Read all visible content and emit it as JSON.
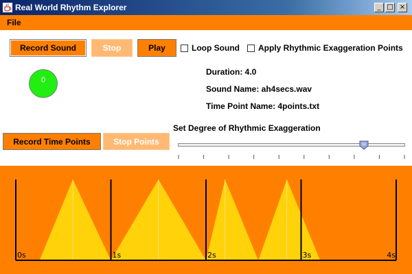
{
  "window": {
    "title": "Real World Rhythm Explorer",
    "controls": {
      "minimize": "_",
      "maximize": "□",
      "close": "×"
    }
  },
  "menu": {
    "file": "File"
  },
  "controls": {
    "record_sound": "Record Sound",
    "stop": "Stop",
    "play": "Play",
    "loop_sound": {
      "label": "Loop Sound",
      "checked": false
    },
    "apply_points": {
      "label": "Apply Rhythmic Exaggeration Points",
      "checked": false
    },
    "record_time_points": "Record Time Points",
    "stop_points": "Stop Points"
  },
  "indicator": {
    "value": "0",
    "color": "#22ee11"
  },
  "info": {
    "duration": "Duration: 4.0",
    "sound_name": "Sound Name: ah4secs.wav",
    "time_point_name": "Time Point Name: 4points.txt"
  },
  "slider": {
    "label": "Set Degree of Rhythmic Exaggeration",
    "value_fraction": 0.82,
    "tick_count": 10
  },
  "waveform": {
    "duration_seconds": 4,
    "time_labels": [
      "0s",
      "1s",
      "2s",
      "3s",
      "4s"
    ],
    "peaks": [
      {
        "start": 0.25,
        "peak": 0.6,
        "end": 1.0
      },
      {
        "start": 1.0,
        "peak": 1.5,
        "end": 2.0
      },
      {
        "start": 2.0,
        "peak": 2.2,
        "end": 2.55
      },
      {
        "start": 2.55,
        "peak": 2.85,
        "end": 3.2
      }
    ],
    "markers": [
      0.6,
      1.5,
      2.2,
      2.85
    ],
    "colors": {
      "background": "#ff8000",
      "wave": "#ffd20a",
      "marker": "#f2e07a",
      "axis": "#000000"
    }
  },
  "colors": {
    "accent": "#ff8000",
    "titlebar": "#0a246a"
  }
}
